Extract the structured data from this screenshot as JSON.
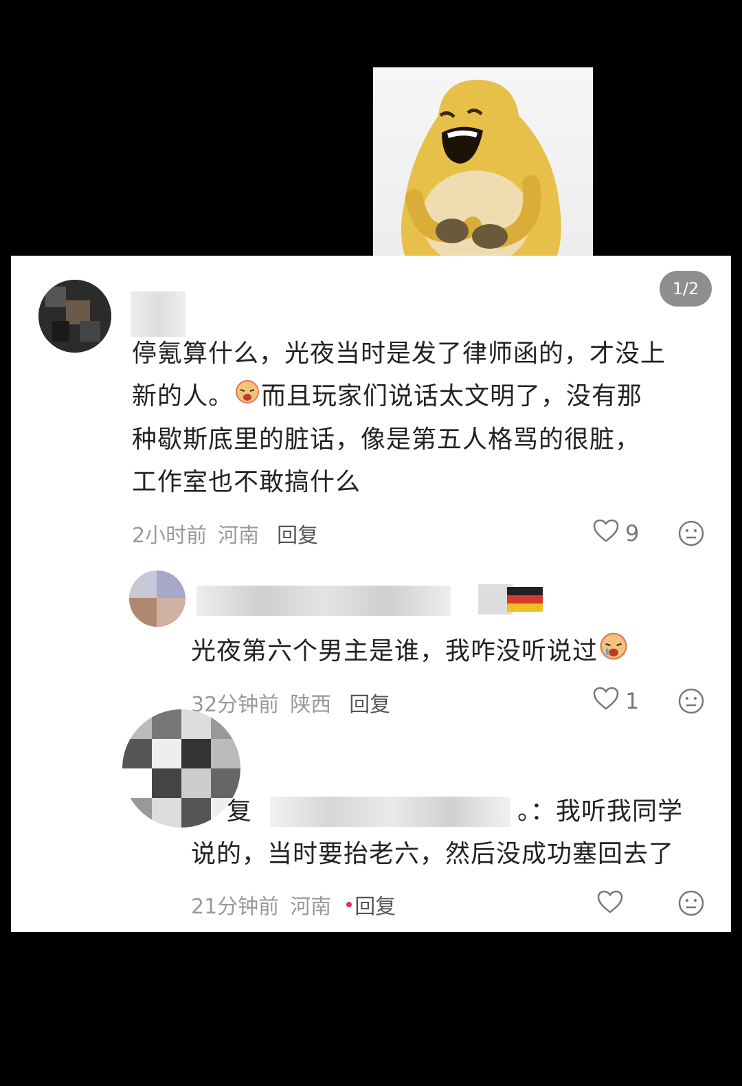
{
  "pager": {
    "text": "1/2"
  },
  "comments": [
    {
      "text_lines": [
        "停氪算什么，光夜当时是发了律师函的，才没上",
        "新的人。",
        "而且玩家们说话太文明了，没有那",
        "种歇斯底里的脏话，像是第五人格骂的很脏，",
        "工作室也不敢搞什么"
      ],
      "time": "2小时前",
      "region": "河南",
      "reply": "回复",
      "likes": "9"
    },
    {
      "text": "光夜第六个男主是谁，我咋没听说过",
      "time": "32分钟前",
      "region": "陕西",
      "reply": "回复",
      "likes": "1"
    },
    {
      "text_line1_left": "复",
      "text_line1_right": "。：我听我同学",
      "text_line2": "说的，当时要抬老六，然后没成功塞回去了",
      "time": "21分钟前",
      "region": "河南",
      "reply": "回复"
    }
  ],
  "icons": {
    "like": "heart-outline-icon",
    "react": "neutral-face-icon",
    "emoji": "crying-face-emoji-icon"
  },
  "colors": {
    "sticker_yellow": "#e7c04a",
    "text": "#222222",
    "meta": "#999999"
  }
}
